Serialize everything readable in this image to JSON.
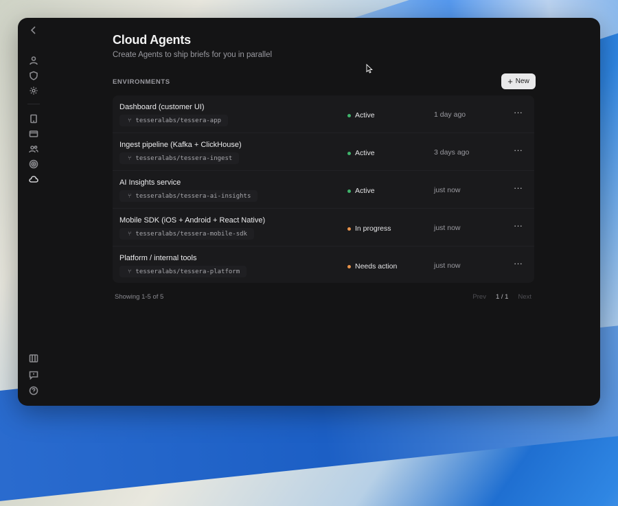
{
  "header": {
    "title": "Cloud Agents",
    "subtitle": "Create Agents to ship briefs for you in parallel"
  },
  "section_label": "ENVIRONMENTS",
  "new_button": {
    "label": "New"
  },
  "environments": [
    {
      "name": "Dashboard (customer UI)",
      "repo": "tesseralabs/tessera-app",
      "status": "Active",
      "status_color": "#3fb36b",
      "updated": "1 day ago"
    },
    {
      "name": "Ingest pipeline (Kafka + ClickHouse)",
      "repo": "tesseralabs/tessera-ingest",
      "status": "Active",
      "status_color": "#3fb36b",
      "updated": "3 days ago"
    },
    {
      "name": "AI Insights service",
      "repo": "tesseralabs/tessera-ai-insights",
      "status": "Active",
      "status_color": "#3fb36b",
      "updated": "just now"
    },
    {
      "name": "Mobile SDK (iOS + Android + React Native)",
      "repo": "tesseralabs/tessera-mobile-sdk",
      "status": "In progress",
      "status_color": "#e8934a",
      "updated": "just now"
    },
    {
      "name": "Platform / internal tools",
      "repo": "tesseralabs/tessera-platform",
      "status": "Needs action",
      "status_color": "#e8934a",
      "updated": "just now"
    }
  ],
  "footer": {
    "showing": "Showing 1-5 of 5",
    "prev": "Prev",
    "page": "1 / 1",
    "next": "Next"
  },
  "sidebar": {
    "icons": [
      "back-icon",
      "user-icon",
      "shield-icon",
      "gear-icon",
      "tablet-icon",
      "credit-card-icon",
      "users-icon",
      "target-icon",
      "cloud-icon",
      "columns-icon",
      "feedback-icon",
      "help-icon"
    ]
  }
}
